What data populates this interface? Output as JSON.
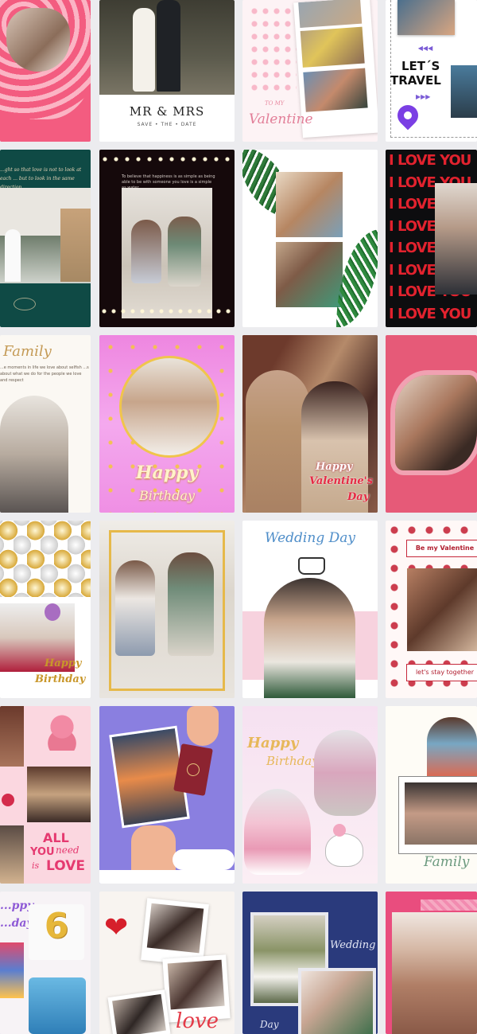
{
  "tiles": {
    "t02": {
      "title": "MR & MRS",
      "subtitle": "SAVE • THE • DATE"
    },
    "t03": {
      "l1": "TO MY",
      "l2": "Valentine"
    },
    "t04": {
      "l1": "LET´S",
      "l2": "TRAVEL"
    },
    "t05": {
      "quote": "...ght so that love is not to look at each ... but to look in the same direction"
    },
    "t06": {
      "quote": "To believe that happiness is as simple as being able to be with someone you love is a simple as water"
    },
    "t08": {
      "line": "I LOVE YOU"
    },
    "t09": {
      "title": "Family",
      "text": "...e moments in life we love about selfish ...s about what we do for the people we love and respect"
    },
    "t10": {
      "l1": "Happy",
      "l2": "Birthday"
    },
    "t11": {
      "l1": "Happy",
      "l2": "Valentine's",
      "l3": "Day"
    },
    "t13": {
      "l1": "Happy",
      "l2": "Birthday"
    },
    "t15": {
      "title": "Wedding Day"
    },
    "t16": {
      "top": "Be my Valentine",
      "bottom": "let's stay together"
    },
    "t17": {
      "l1": "ALL",
      "l2": "YOU",
      "l3": "need",
      "l4": "is",
      "l5": "LOVE"
    },
    "t18": {
      "passport": "PASSPORT"
    },
    "t19": {
      "l1": "Happy",
      "l2": "Birthday"
    },
    "t20": {
      "title": "Family"
    },
    "t21": {
      "l1": "...ppy",
      "l2": "...day",
      "num": "6"
    },
    "t22": {
      "word": "love"
    },
    "t23": {
      "l1": "Wedding",
      "l2": "Day"
    }
  },
  "colors": {
    "bg": "#ececef",
    "pink": "#f0577d",
    "teal": "#0f4a45",
    "navy": "#2a3a7c",
    "red": "#d61f2b"
  },
  "icons": [
    "heart-icon",
    "location-pin-icon",
    "balloon-icon",
    "unicorn-icon",
    "teddy-bear-icon",
    "rose-icon",
    "airplane-icon",
    "passport-icon"
  ]
}
